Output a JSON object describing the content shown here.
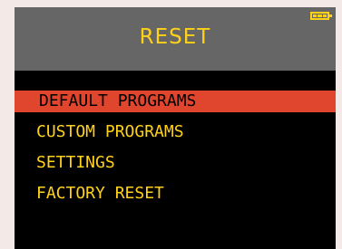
{
  "header": {
    "title": "RESET",
    "battery_icon": "battery-full-icon"
  },
  "menu": {
    "items": [
      {
        "label": "DEFAULT PROGRAMS",
        "selected": true
      },
      {
        "label": "CUSTOM PROGRAMS",
        "selected": false
      },
      {
        "label": "SETTINGS",
        "selected": false
      },
      {
        "label": "FACTORY RESET",
        "selected": false
      }
    ]
  },
  "colors": {
    "header_bg": "#666666",
    "text_accent": "#ffd21a",
    "selection_bg": "#e0462e",
    "screen_bg": "#000000",
    "frame_bg": "#f3e9e6"
  }
}
